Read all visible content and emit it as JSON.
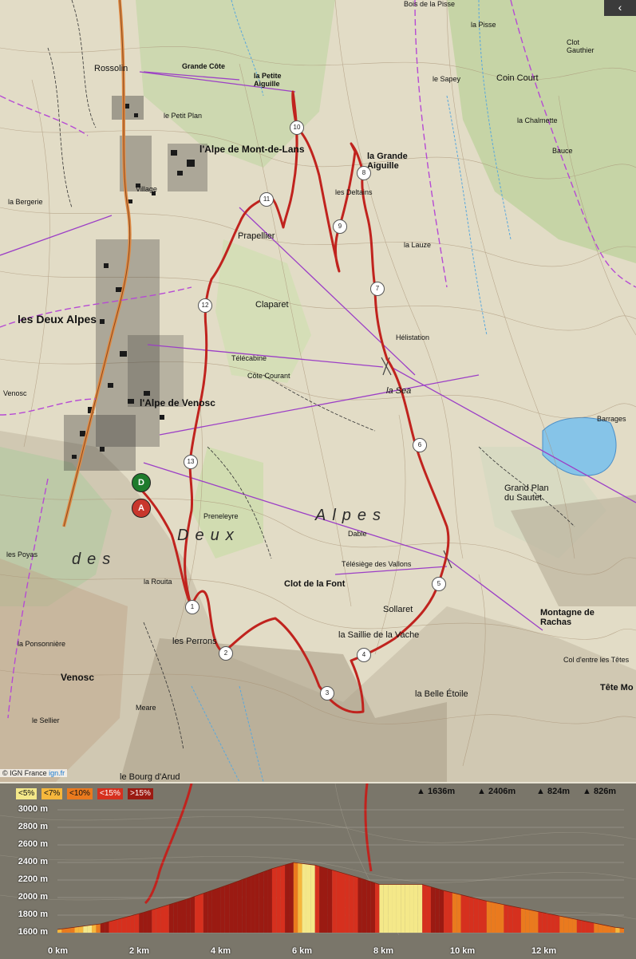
{
  "map": {
    "collapse_icon": "‹",
    "credit": {
      "prefix": "© IGN France",
      "brand": "ign.fr"
    },
    "labels": {
      "deux_alpes": "les Deux Alpes",
      "alpe_mont_de_lans": "l'Alpe de Mont-de-Lans",
      "alpe_venosc": "l'Alpe de Venosc",
      "grande_aiguille": "la Grande Aiguille",
      "petite_aiguille": "la Petite Aiguille",
      "deux_alpes_area": "Deux Alpes",
      "des": "des",
      "venosc": "Venosc",
      "bourg_arud": "le Bourg d'Arud",
      "rossolin": "Rossolin",
      "grande_cote": "Grande Côte",
      "petit_plan": "le Petit Plan",
      "village": "Village",
      "prapellier": "Prapellier",
      "claparet": "Claparet",
      "cote_courant": "Côte Courant",
      "la_sea": "la Sea",
      "grand_plan_sautet": "Grand Plan du Sautet",
      "montagne_rachas": "Montagne de Rachas",
      "tete_mo": "Tête Mo",
      "sollaret": "Sollaret",
      "saillie_vache": "la Saillie de la Vache",
      "belle_etoile": "la Belle Étoile",
      "clot_font": "Clot de la Font",
      "perrons": "les Perrons",
      "ponsonniere": "la Ponsonnière",
      "le_sellier": "le Sellier",
      "la_rouita": "la Rouita",
      "preneleyre": "Preneleyre",
      "meare": "Meare",
      "coin_court": "Coin Court",
      "le_sapey": "le Sapey",
      "la_chalmette": "la Chalmette",
      "bauce": "Bauce",
      "la_lauze": "la Lauze",
      "bois_pisse": "Bois de la Pisse",
      "la_pisse": "la Pisse",
      "clot_gauthier": "Clot Gauthier",
      "les_deltains": "les Deltains",
      "barrages": "Barrages",
      "col_tetes": "Col d'entre les Têtes",
      "la_bergerie": "la Bergerie",
      "venosc_left": "Venosc",
      "les_poyas": "les Poyas",
      "telesiege_vallons": "Télésiège des Vallons",
      "telecabine": "Télécabine",
      "heli": "Hélistation",
      "dabie": "Dable"
    },
    "waypoints": [
      "1",
      "2",
      "3",
      "4",
      "5",
      "6",
      "7",
      "8",
      "9",
      "10",
      "11",
      "12",
      "13"
    ],
    "start_marker": "D",
    "end_marker": "A"
  },
  "profile": {
    "legend": [
      "<5%",
      "<7%",
      "<10%",
      "<15%",
      ">15%"
    ],
    "legend_colors": [
      "#f4e889",
      "#f6b73c",
      "#ea7a1e",
      "#d6301e",
      "#9b1a12"
    ],
    "stats": [
      {
        "icon": "ascent-icon",
        "value": "1636m"
      },
      {
        "icon": "peak-icon",
        "value": "2406m"
      },
      {
        "icon": "climb-icon",
        "value": "824m"
      },
      {
        "icon": "descent-icon",
        "value": "826m"
      }
    ],
    "y_labels": [
      "3000 m",
      "2800 m",
      "2600 m",
      "2400 m",
      "2200 m",
      "2000 m",
      "1800 m",
      "1600 m"
    ],
    "x_labels": [
      "0 km",
      "2 km",
      "4 km",
      "6 km",
      "8 km",
      "10 km",
      "12 km"
    ]
  },
  "chart_data": {
    "type": "area",
    "ylabel": "",
    "xlabel": "",
    "ylim": [
      1600,
      3000
    ],
    "xlim": [
      0,
      13.2
    ],
    "x": [
      0,
      1,
      2,
      3,
      4,
      5,
      5.5,
      6,
      7,
      7.5,
      8,
      8.5,
      9,
      10,
      11,
      12,
      13,
      13.2
    ],
    "values": [
      1636,
      1700,
      1830,
      1980,
      2150,
      2330,
      2400,
      2370,
      2230,
      2150,
      2150,
      2150,
      2080,
      1960,
      1860,
      1760,
      1660,
      1650
    ]
  }
}
